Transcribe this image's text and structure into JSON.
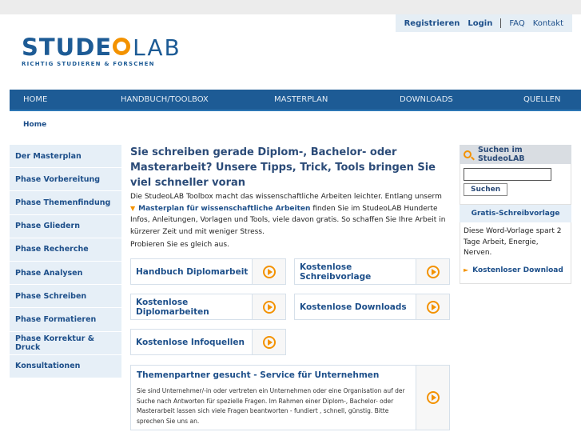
{
  "header": {
    "links": {
      "register": "Registrieren",
      "login": "Login",
      "faq": "FAQ",
      "contact": "Kontakt"
    },
    "logo": {
      "main": "STUDE",
      "lab": "LAB",
      "tagline": "RICHTIG STUDIEREN & FORSCHEN"
    }
  },
  "nav": [
    "HOME",
    "HANDBUCH/TOOLBOX",
    "MASTERPLAN",
    "DOWNLOADS",
    "QUELLEN"
  ],
  "breadcrumb": "Home",
  "sidebar": [
    "Der Masterplan",
    "Phase Vorbereitung",
    "Phase Themenfindung",
    "Phase Gliedern",
    "Phase Recherche",
    "Phase Analysen",
    "Phase Schreiben",
    "Phase Formatieren",
    "Phase Korrektur & Druck",
    "Konsultationen"
  ],
  "main": {
    "headline": "Sie schreiben gerade Diplom-, Bachelor- oder Masterarbeit? Unsere Tipps, Trick, Tools bringen Sie viel schneller voran",
    "intro_1": "Die StudeoLAB Toolbox macht das wissenschaftliche Arbeiten leichter. Entlang unserm",
    "intro_link": "Masterplan für wissenschaftliche Arbeiten",
    "intro_2": "finden Sie im StudeoLAB Hunderte Infos, Anleitungen, Vorlagen und Tools, viele davon gratis. So schaffen Sie Ihre Arbeit in kürzerer Zeit und mit weniger Stress.",
    "try": "Probieren Sie es gleich aus.",
    "boxes": [
      "Handbuch Diplomarbeit",
      "Kostenlose Schreibvorlage",
      "Kostenlose Diplomarbeiten",
      "Kostenlose Downloads",
      "Kostenlose Infoquellen"
    ],
    "partner": {
      "title": "Themenpartner gesucht - Service für Unternehmen",
      "text": "Sie sind Unternehmer/-in oder vertreten ein Unternehmen oder eine Organisation auf der Suche nach Antworten für spezielle Fragen. Im Rahmen einer Diplom-, Bachelor- oder Masterarbeit lassen sich viele Fragen beantworten - fundiert , schnell, günstig. Bitte sprechen Sie uns an."
    }
  },
  "right": {
    "search_title": "Suchen im StudeoLAB",
    "search_value": "",
    "search_button": "Suchen",
    "promo_title": "Gratis-Schreibvorlage",
    "promo_text": "Diese Word-Vorlage spart 2 Tage Arbeit, Energie, Nerven.",
    "promo_link": "Kostenloser Download"
  }
}
